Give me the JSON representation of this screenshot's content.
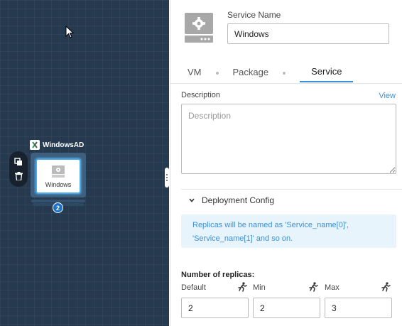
{
  "canvas": {
    "app_name": "WindowsAD",
    "node_label": "Windows",
    "node_icon_text": "WINDOWS",
    "replica_count": "2"
  },
  "panel": {
    "service_name_label": "Service Name",
    "service_name_value": "Windows",
    "tabs": [
      {
        "label": "VM",
        "active": false
      },
      {
        "label": "Package",
        "active": false
      },
      {
        "label": "Service",
        "active": true
      }
    ],
    "description_label": "Description",
    "view_link": "View",
    "description_placeholder": "Description",
    "deployment_config_label": "Deployment Config",
    "info_text": "Replicas will be named as 'Service_name[0]', 'Service_name[1]' and so on.",
    "replicas_label": "Number of replicas:",
    "replicas": {
      "default_label": "Default",
      "default_value": "2",
      "min_label": "Min",
      "min_value": "2",
      "max_label": "Max",
      "max_value": "3"
    }
  },
  "colors": {
    "canvas_bg": "#263a4f",
    "accent": "#3a8fd6",
    "info_bg": "#e8f4fc"
  }
}
